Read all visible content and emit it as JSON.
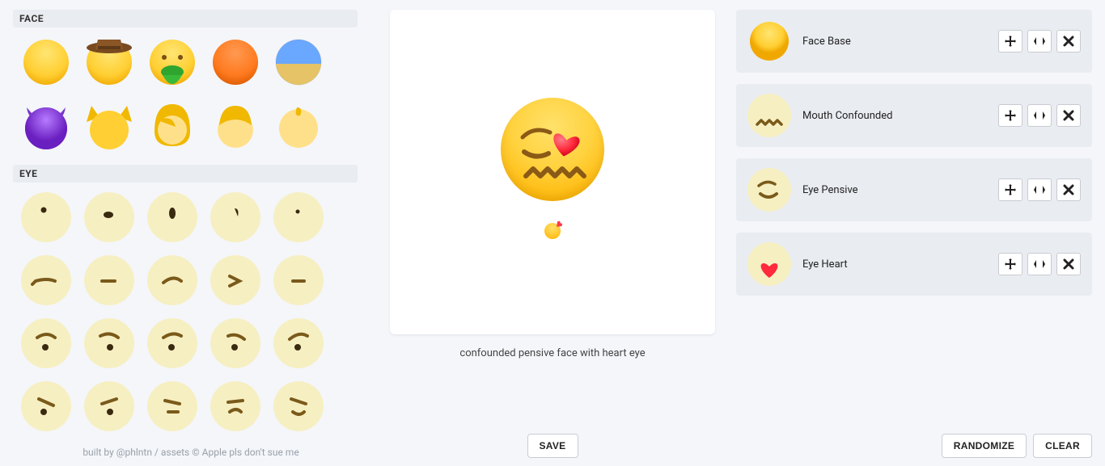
{
  "categories": {
    "face": {
      "label": "FACE"
    },
    "eye": {
      "label": "EYE"
    }
  },
  "footer_credits": "built by @phlntn  /  assets © Apple pls don't sue me",
  "caption": "confounded pensive face with heart eye",
  "buttons": {
    "save": "SAVE",
    "randomize": "RANDOMIZE",
    "clear": "CLEAR"
  },
  "layers": [
    {
      "name": "Face Base"
    },
    {
      "name": "Mouth Confounded"
    },
    {
      "name": "Eye Pensive"
    },
    {
      "name": "Eye Heart"
    }
  ],
  "face_tiles": [
    "base-yellow",
    "cowboy",
    "vomit",
    "orange",
    "sunset",
    "devil-purple",
    "cat",
    "woman-hair",
    "man-hair",
    "baby"
  ],
  "eye_tiles": [
    "dot-up",
    "dot-oval-h",
    "dot-oval-v",
    "dot-hook",
    "dot-tiny",
    "line-lash",
    "line-flat",
    "line-curve",
    "gt",
    "dash",
    "brow-dot-1",
    "brow-dot-2",
    "brow-dot-3",
    "brow-dot-4",
    "brow-dot-5",
    "brow-slant-1",
    "brow-slant-2",
    "brow-slant-3",
    "brow-slant-4",
    "brow-slant-5"
  ]
}
